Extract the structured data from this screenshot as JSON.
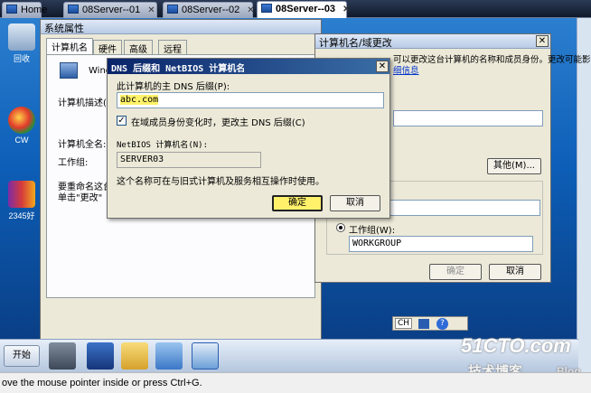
{
  "host_tabs": [
    {
      "label": "Home"
    },
    {
      "label": "08Server--01"
    },
    {
      "label": "08Server--02"
    },
    {
      "label": "08Server--03"
    }
  ],
  "desktop_icons": [
    {
      "label": "回收"
    },
    {
      "label": "CW"
    },
    {
      "label": "2345好"
    }
  ],
  "sysprops": {
    "title": "系统属性",
    "tabs": [
      "计算机名",
      "硬件",
      "高级",
      "远程"
    ],
    "windows_text": "Wind",
    "desc_label": "计算机描述(",
    "fullname_label": "计算机全名:",
    "workgroup_label": "工作组:",
    "rename_text1": "要重命名这台",
    "rename_text2": "单击\"更改\""
  },
  "rename": {
    "title": "计算机名/域更改",
    "intro_text": "可以更改这台计算机的名称和成员身份。更改可能影响网",
    "info_link": "细信息",
    "other_button": "其他(M)...",
    "workgroup_radio": "工作组(W):",
    "workgroup_value": "WORKGROUP",
    "ok_button": "确定",
    "cancel_button": "取消"
  },
  "dns": {
    "title": "DNS 后缀和 NetBIOS 计算机名",
    "suffix_label": "此计算机的主 DNS 后缀(P):",
    "suffix_value": "abc.com",
    "checkbox_label": "在域成员身份变化时，更改主 DNS 后缀(C)",
    "netbios_label": "NetBIOS 计算机名(N):",
    "netbios_value": "SERVER03",
    "note": "这个名称可在与旧式计算机及服务相互操作时使用。",
    "ok_button": "确定",
    "cancel_button": "取消"
  },
  "taskbar": {
    "start_label": "开始",
    "lang_label": "CH"
  },
  "status": {
    "text": "ove the mouse pointer inside or press Ctrl+G."
  },
  "watermark": {
    "brand": "51CTO.com",
    "sub": "技术博客",
    "blog": "Blog"
  },
  "colors": {
    "highlight": "#fff26a",
    "dialog_title": "#0a246a",
    "desktop": "#0d5fb8"
  }
}
